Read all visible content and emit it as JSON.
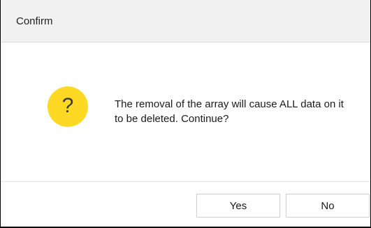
{
  "dialog": {
    "title": "Confirm",
    "icon": "question-icon",
    "icon_glyph": "?",
    "icon_color": "#fed923",
    "message": "The removal of the array will cause ALL data on it to be deleted. Continue?",
    "buttons": {
      "yes_label": "Yes",
      "no_label": "No"
    }
  }
}
